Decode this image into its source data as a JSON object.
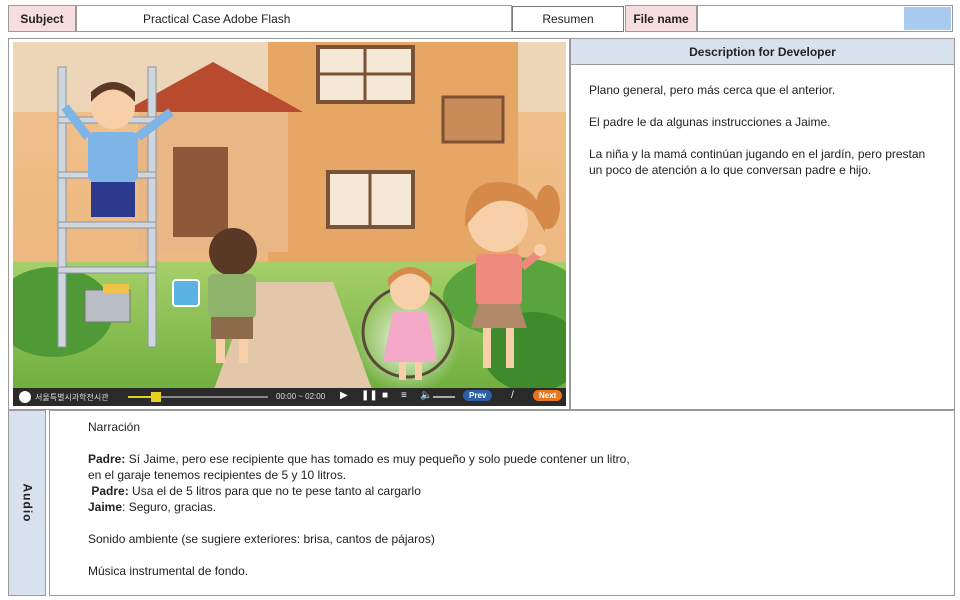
{
  "header": {
    "subject_label": "Subject",
    "subject_value": "Practical Case Adobe Flash",
    "resumen": "Resumen",
    "filename_label": "File name",
    "filename_value": ""
  },
  "player": {
    "brand": "서울특별시과학전시관",
    "time": "00:00 ~ 02:00",
    "prev": "Prev",
    "separator": "/",
    "next": "Next",
    "progress": 0.2
  },
  "description": {
    "title": "Description for Developer",
    "paragraphs": [
      "Plano general, pero más cerca que el anterior.",
      "El padre le da algunas instrucciones a Jaime.",
      "La niña y la mamá continúan jugando en el jardín, pero prestan un poco de atención a lo que conversan padre e hijo."
    ]
  },
  "audio": {
    "tab_label": "Audio",
    "narration": "Narración",
    "line1_speaker": "Padre:",
    "line1_text": " Sí Jaime, pero ese recipiente que has tomado es muy pequeño y solo puede contener un litro,",
    "line1_cont": "en el garaje  tenemos recipientes de 5 y 10 litros.",
    "line2_speaker": "Padre:",
    "line2_text": " Usa el de 5 litros para que no te pese tanto al cargarlo",
    "line3_speaker": "Jaime",
    "line3_text": ": Seguro, gracias.",
    "ambient": "Sonido ambiente (se sugiere exteriores: brisa, cantos de pájaros)",
    "music": "Música instrumental de fondo."
  },
  "colors": {
    "label_bg": "#f7dede",
    "panel_header_bg": "#d8e2ef",
    "accent_blue": "#a9cbf0",
    "prev_button": "#2c5fa8",
    "next_button": "#e8761e"
  }
}
